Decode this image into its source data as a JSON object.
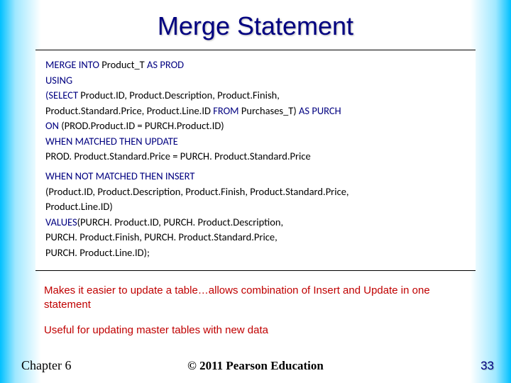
{
  "title": "Merge Statement",
  "code": {
    "l1_a": "MERGE INTO",
    "l1_b": " Product_T ",
    "l1_c": "AS PROD",
    "l2": "USING",
    "l3_a": "(SELECT",
    "l3_b": " Product.ID, Product.Description, Product.Finish,",
    "l4_a": "Product.Standard.Price, Product.Line.ID ",
    "l4_b": "FROM",
    "l4_c": " Purchases_T) ",
    "l4_d": "AS PURCH",
    "l5_a": "ON",
    "l5_b": " (PROD.Product.ID = PURCH.Product.ID)",
    "l6": "WHEN MATCHED THEN UPDATE",
    "l7": "PROD. Product.Standard.Price = PURCH. Product.Standard.Price",
    "l8": "WHEN NOT MATCHED THEN INSERT",
    "l9": "(Product.ID, Product.Description, Product.Finish, Product.Standard.Price,",
    "l10": "Product.Line.ID)",
    "l11_a": "VALUES",
    "l11_b": "(PURCH. Product.ID, PURCH. Product.Description,",
    "l12": "PURCH. Product.Finish, PURCH. Product.Standard.Price,",
    "l13": "PURCH. Product.Line.ID);"
  },
  "desc1": "Makes it easier to update a table…allows combination of Insert and Update in one statement",
  "desc2": "Useful for updating master tables with new data",
  "footer": {
    "chapter": "Chapter 6",
    "copyright": "© 2011 Pearson Education",
    "page": "33"
  }
}
